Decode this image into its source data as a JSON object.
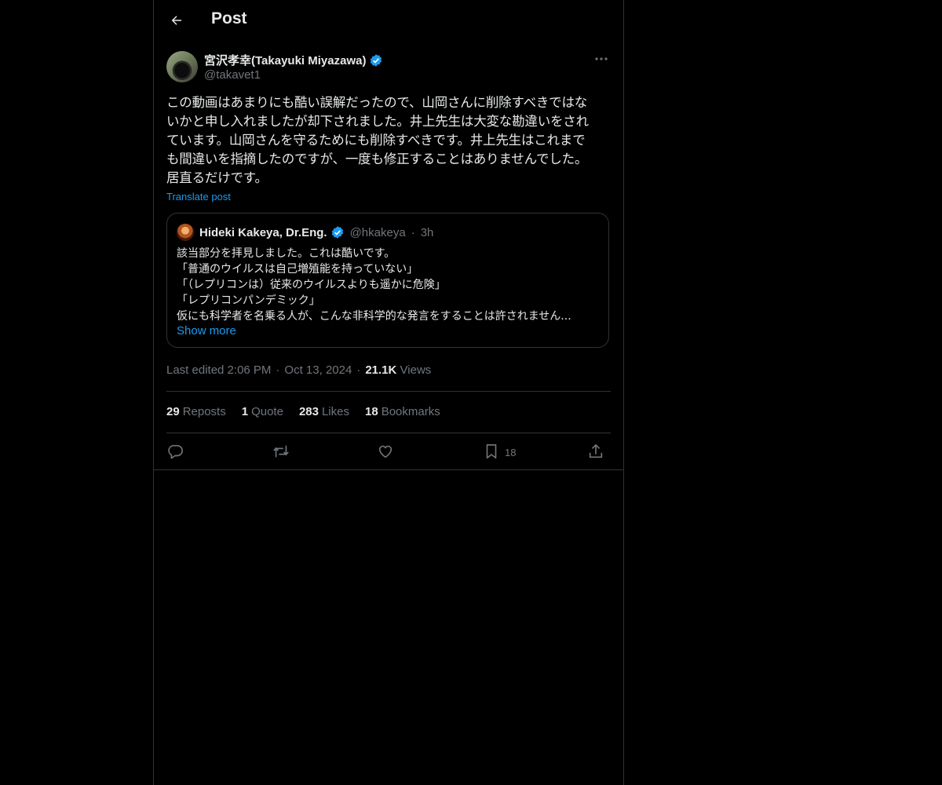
{
  "header": {
    "title": "Post"
  },
  "post": {
    "author_name": "宮沢孝幸(Takayuki Miyazawa)",
    "author_handle": "@takavet1",
    "text_lines": [
      "この動画はあまりにも酷い誤解だったので、山岡さんに削除すべきではな",
      "いかと申し入れましたが却下されました。井上先生は大変な勘違いをされ",
      "ています。山岡さんを守るためにも削除すべきです。井上先生はこれまで",
      "も間違いを指摘したのですが、一度も修正することはありませんでした。",
      "居直るだけです。"
    ],
    "translate_label": "Translate post"
  },
  "quote": {
    "name": "Hideki Kakeya, Dr.Eng.",
    "handle": "@hkakeya",
    "dot": "·",
    "time": "3h",
    "lines": [
      "該当部分を拝見しました。これは酷いです。",
      "「普通のウイルスは自己増殖能を持っていない」",
      "「（レプリコンは）従来のウイルスよりも遥かに危険」",
      "「レプリコンパンデミック」",
      "仮にも科学者を名乗る人が、こんな非科学的な発言をすることは許されません..."
    ],
    "show_more": "Show more"
  },
  "meta": {
    "edited": "Last edited 2:06 PM",
    "sep": "·",
    "date": "Oct 13, 2024",
    "views_count": "21.1K",
    "views_label": "Views"
  },
  "stats": {
    "reposts_count": "29",
    "reposts_label": "Reposts",
    "quote_count": "1",
    "quote_label": "Quote",
    "likes_count": "283",
    "likes_label": "Likes",
    "bookmarks_count": "18",
    "bookmarks_label": "Bookmarks"
  },
  "actions": {
    "bookmark_count": "18"
  },
  "colors": {
    "background": "#000000",
    "text": "#e7e9ea",
    "muted": "#71767b",
    "accent": "#1d9bf0",
    "border": "#2f3336"
  },
  "icons": [
    "back-arrow-icon",
    "verified-badge-icon",
    "more-icon",
    "reply-icon",
    "repost-icon",
    "like-icon",
    "bookmark-icon",
    "share-icon"
  ]
}
